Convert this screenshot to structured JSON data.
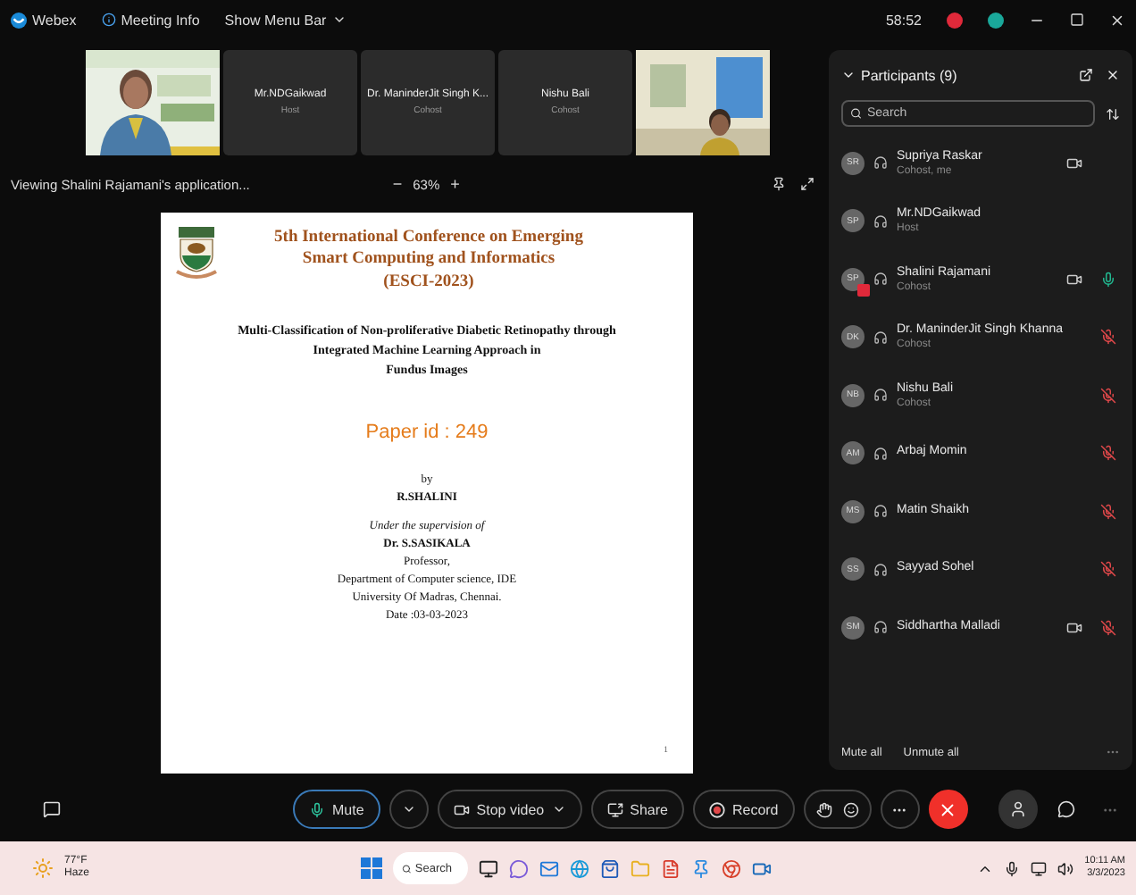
{
  "window": {
    "menu": [
      {
        "kind": "logo",
        "label": "Webex"
      },
      {
        "kind": "info",
        "label": "Meeting Info"
      },
      {
        "kind": "dropdown",
        "label": "Show Menu Bar"
      }
    ],
    "timer": "58:52"
  },
  "video_strip": [
    {
      "kind": "picture"
    },
    {
      "kind": "name",
      "name": "Mr.NDGaikwad",
      "role": "Host"
    },
    {
      "kind": "name",
      "name": "Dr. ManinderJit Singh K...",
      "role": "Cohost"
    },
    {
      "kind": "name",
      "name": "Nishu Bali",
      "role": "Cohost"
    },
    {
      "kind": "picture"
    }
  ],
  "share_bar": {
    "label": "Viewing Shalini Rajamani's application...",
    "zoom_out": "−",
    "zoom": "63%",
    "zoom_in": "+"
  },
  "slide": {
    "conference": [
      "5th International Conference on Emerging",
      "Smart Computing and Informatics",
      "(ESCI-2023)"
    ],
    "title": [
      "Multi-Classification of Non-proliferative Diabetic Retinopathy through",
      "Integrated Machine Learning Approach in",
      "Fundus Images"
    ],
    "paper_id": "Paper id : 249",
    "by": "by",
    "author": "R.SHALINI",
    "supervision": "Under the supervision of",
    "supervisor": "Dr. S.SASIKALA",
    "details": [
      "Professor,",
      "Department of  Computer science, IDE",
      "University Of  Madras, Chennai.",
      "Date :03-03-2023"
    ],
    "page": "1"
  },
  "participants": {
    "title": "Participants (9)",
    "search": {
      "placeholder": "Search"
    },
    "items": [
      {
        "initials": "SR",
        "name": "Supriya Raskar",
        "role": "Cohost, me",
        "video": true,
        "sharing": false
      },
      {
        "initials": "SP",
        "name": "Mr.NDGaikwad",
        "role": "Host",
        "video": false,
        "sharing": false
      },
      {
        "initials": "SP",
        "name": "Shalini Rajamani",
        "role": "Cohost",
        "video": true,
        "sharing": true,
        "muted": false
      },
      {
        "initials": "DK",
        "name": "Dr. ManinderJit Singh Khanna",
        "role": "Cohost",
        "video": false,
        "sharing": false,
        "muted": true
      },
      {
        "initials": "NB",
        "name": "Nishu Bali",
        "role": "Cohost",
        "video": false,
        "sharing": false,
        "muted": true
      },
      {
        "initials": "AM",
        "name": "Arbaj Momin",
        "video": false,
        "sharing": false,
        "muted": true
      },
      {
        "initials": "MS",
        "name": "Matin Shaikh",
        "video": false,
        "sharing": false,
        "muted": true
      },
      {
        "initials": "SS",
        "name": "Sayyad Sohel",
        "video": false,
        "sharing": false,
        "muted": true
      },
      {
        "initials": "SM",
        "name": "Siddhartha Malladi",
        "video": true,
        "sharing": false,
        "muted": true
      }
    ],
    "actions": [
      "Mute all",
      "Unmute all"
    ]
  },
  "controls": [
    {
      "kind": "mute",
      "label": "Mute",
      "selected": true
    },
    {
      "kind": "video",
      "label": "Stop video",
      "selected": false
    },
    {
      "kind": "share",
      "label": "Share",
      "selected": false
    },
    {
      "kind": "record",
      "label": "Record",
      "selected": false
    }
  ],
  "taskbar": {
    "weather": {
      "temp": "77°F",
      "condition": "Haze"
    },
    "search": {
      "placeholder": "Search"
    },
    "time": "10:11 AM",
    "date": "3/3/2023"
  }
}
